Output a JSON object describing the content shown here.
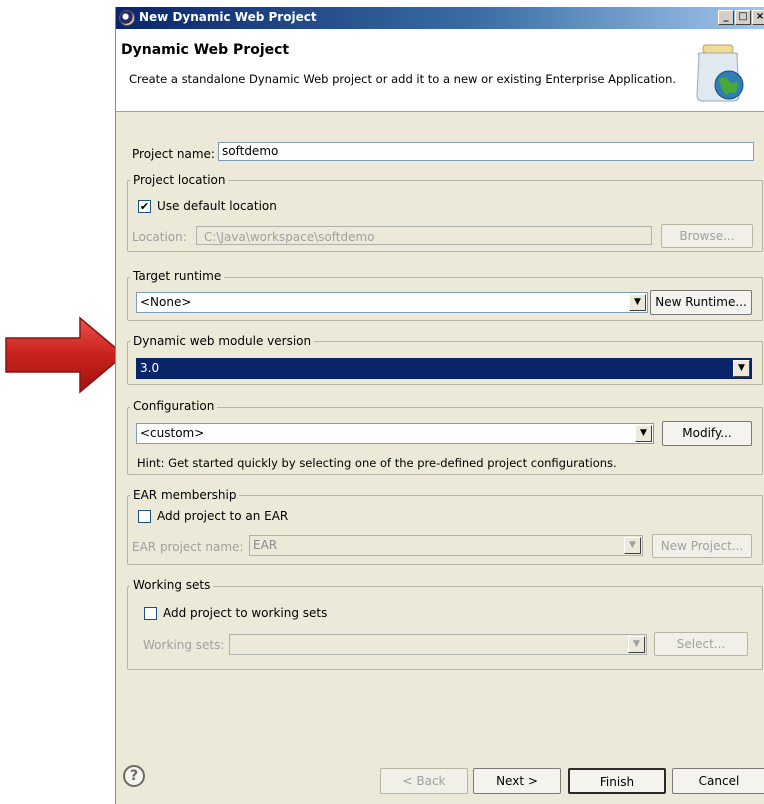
{
  "window": {
    "title": "New Dynamic Web Project",
    "controls": {
      "minimize": "_",
      "maximize": "□",
      "close": "×"
    }
  },
  "banner": {
    "title": "Dynamic Web Project",
    "description": "Create a standalone Dynamic Web project or add it to a new or existing Enterprise Application."
  },
  "project_name": {
    "label": "Project name:",
    "value": "softdemo"
  },
  "project_location": {
    "group_title": "Project location",
    "use_default_label": "Use default location",
    "use_default_checked": true,
    "location_label": "Location:",
    "location_value": "C:\\Java\\workspace\\softdemo",
    "browse_label": "Browse..."
  },
  "target_runtime": {
    "group_title": "Target runtime",
    "selected": "<None>",
    "new_runtime_label": "New Runtime..."
  },
  "module_version": {
    "group_title": "Dynamic web module version",
    "selected": "3.0"
  },
  "configuration": {
    "group_title": "Configuration",
    "selected": "<custom>",
    "modify_label": "Modify...",
    "hint": "Hint: Get started quickly by selecting one of the pre-defined project configurations."
  },
  "ear_membership": {
    "group_title": "EAR membership",
    "add_label": "Add project to an EAR",
    "add_checked": false,
    "name_label": "EAR project name:",
    "name_value": "EAR",
    "new_project_label": "New Project..."
  },
  "working_sets": {
    "group_title": "Working sets",
    "add_label": "Add project to working sets",
    "add_checked": false,
    "sets_label": "Working sets:",
    "sets_value": "",
    "select_label": "Select..."
  },
  "footer": {
    "help_glyph": "?",
    "back_label": "< Back",
    "next_label": "Next >",
    "finish_label": "Finish",
    "cancel_label": "Cancel"
  },
  "colors": {
    "arrow": "#d42a24",
    "title_gradient_start": "#0a246a",
    "selection": "#0a246a",
    "dialog_bg": "#ece9d8"
  },
  "icons": [
    "red-arrow-icon",
    "eclipse-icon",
    "jar-globe-icon",
    "help-icon",
    "dropdown-arrow-icon",
    "checkmark-icon"
  ]
}
